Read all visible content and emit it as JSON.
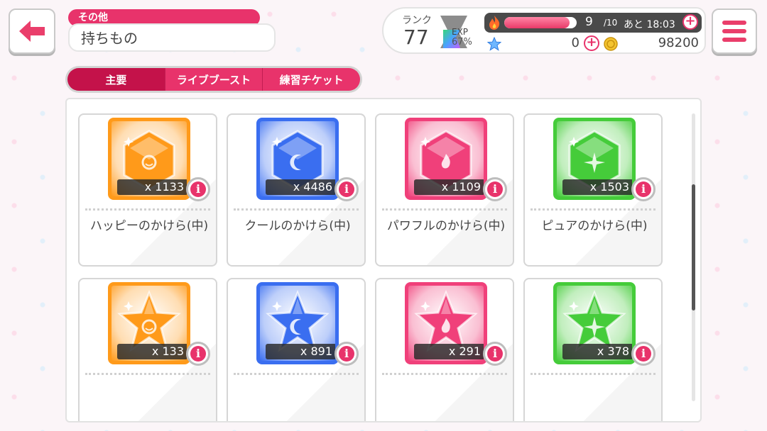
{
  "header": {
    "category": "その他",
    "title": "持ちもの"
  },
  "status": {
    "rank_label": "ランク",
    "rank": "77",
    "exp_label": "EXP",
    "exp_percent": "67%",
    "stamina": "9",
    "stamina_max": "/10",
    "stamina_fill": 0.9,
    "stamina_timer": "あと 18:03",
    "stars": "0",
    "coins": "98200"
  },
  "tabs": [
    {
      "label": "主要",
      "active": true
    },
    {
      "label": "ライブブースト",
      "active": false
    },
    {
      "label": "練習チケット",
      "active": false
    }
  ],
  "items": [
    {
      "name": "ハッピーのかけら(中)",
      "qty": "x 1133",
      "color": "#ff9a1a",
      "shape": "hexagon",
      "symbol": "happy"
    },
    {
      "name": "クールのかけら(中)",
      "qty": "x 4486",
      "color": "#3a6ef0",
      "shape": "hexagon",
      "symbol": "cool"
    },
    {
      "name": "パワフルのかけら(中)",
      "qty": "x 1109",
      "color": "#f0407a",
      "shape": "hexagon",
      "symbol": "powerful"
    },
    {
      "name": "ピュアのかけら(中)",
      "qty": "x 1503",
      "color": "#45cc3a",
      "shape": "hexagon",
      "symbol": "pure"
    },
    {
      "name": "",
      "qty": "x 133",
      "color": "#ff9a1a",
      "shape": "star",
      "symbol": "happy"
    },
    {
      "name": "",
      "qty": "x 891",
      "color": "#3a6ef0",
      "shape": "star",
      "symbol": "cool"
    },
    {
      "name": "",
      "qty": "x 291",
      "color": "#f0407a",
      "shape": "star",
      "symbol": "powerful"
    },
    {
      "name": "",
      "qty": "x 378",
      "color": "#45cc3a",
      "shape": "star",
      "symbol": "pure"
    }
  ]
}
